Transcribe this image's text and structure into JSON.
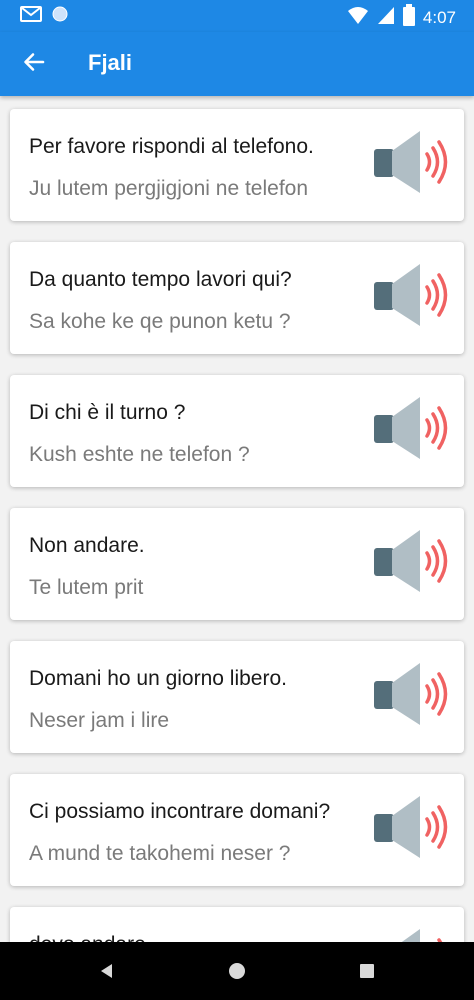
{
  "status_bar": {
    "time": "4:07",
    "icons": [
      "gmail-icon",
      "circle-icon",
      "wifi-icon",
      "signal-icon",
      "battery-icon"
    ]
  },
  "app_bar": {
    "title": "Fjali",
    "back_icon": "arrow-left-icon"
  },
  "colors": {
    "primary": "#1e88e5",
    "phrase_text": "#1a1a1a",
    "translation_text": "#7a7a7a",
    "speaker_body": "#546e7a",
    "speaker_cone": "#b0bec5",
    "sound_waves": "#f06262"
  },
  "phrases": [
    {
      "phrase": "Per favore rispondi al telefono.",
      "translation": "Ju lutem pergjigjoni ne telefon"
    },
    {
      "phrase": "Da quanto tempo lavori qui?",
      "translation": "Sa kohe ke qe punon ketu ?"
    },
    {
      "phrase": "Di chi è il turno ?",
      "translation": "Kush eshte ne telefon ?"
    },
    {
      "phrase": "Non andare.",
      "translation": "Te lutem prit"
    },
    {
      "phrase": "Domani ho un giorno libero.",
      "translation": "Neser jam i lire"
    },
    {
      "phrase": "Ci possiamo incontrare domani?",
      "translation": "A mund te takohemi neser ?"
    },
    {
      "phrase": "devo andare.",
      "translation": ""
    }
  ],
  "nav_bar": {
    "icons": [
      "back-triangle-icon",
      "home-circle-icon",
      "recents-square-icon"
    ]
  }
}
